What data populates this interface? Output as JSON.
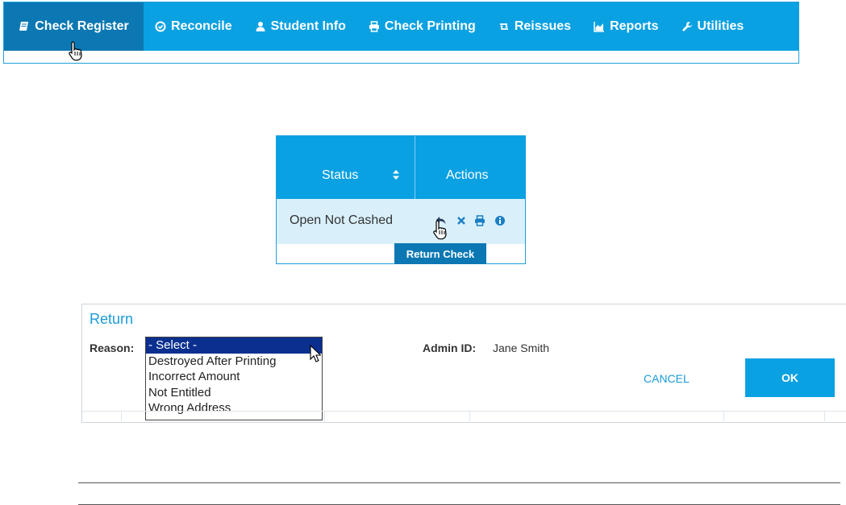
{
  "nav": {
    "items": [
      {
        "label": "Check Register",
        "icon": "book-icon",
        "active": true
      },
      {
        "label": "Reconcile",
        "icon": "check-circle-icon",
        "active": false
      },
      {
        "label": "Student Info",
        "icon": "user-icon",
        "active": false
      },
      {
        "label": "Check Printing",
        "icon": "printer-icon",
        "active": false
      },
      {
        "label": "Reissues",
        "icon": "retweet-icon",
        "active": false
      },
      {
        "label": "Reports",
        "icon": "area-chart-icon",
        "active": false
      },
      {
        "label": "Utilities",
        "icon": "wrench-icon",
        "active": false
      }
    ]
  },
  "table": {
    "columns": [
      "Status",
      "Actions"
    ],
    "rows": [
      {
        "status": "Open Not Cashed",
        "actions": [
          "return-icon",
          "close-icon",
          "printer-icon",
          "info-icon"
        ]
      }
    ],
    "tooltip": "Return Check"
  },
  "dialog": {
    "title": "Return",
    "reason_label": "Reason:",
    "reason_options": [
      "- Select -",
      "Destroyed After Printing",
      "Incorrect Amount",
      "Not Entitled",
      "Wrong Address"
    ],
    "reason_selected": "- Select -",
    "admin_label": "Admin ID:",
    "admin_value": "Jane Smith",
    "cancel_label": "CANCEL",
    "ok_label": "OK"
  },
  "colors": {
    "nav_bg": "#0aa1e2",
    "nav_active": "#0b78b3",
    "row_bg": "#d9f0fb",
    "selected_option": "#0a2f8f",
    "accent": "#1a9bd7"
  }
}
